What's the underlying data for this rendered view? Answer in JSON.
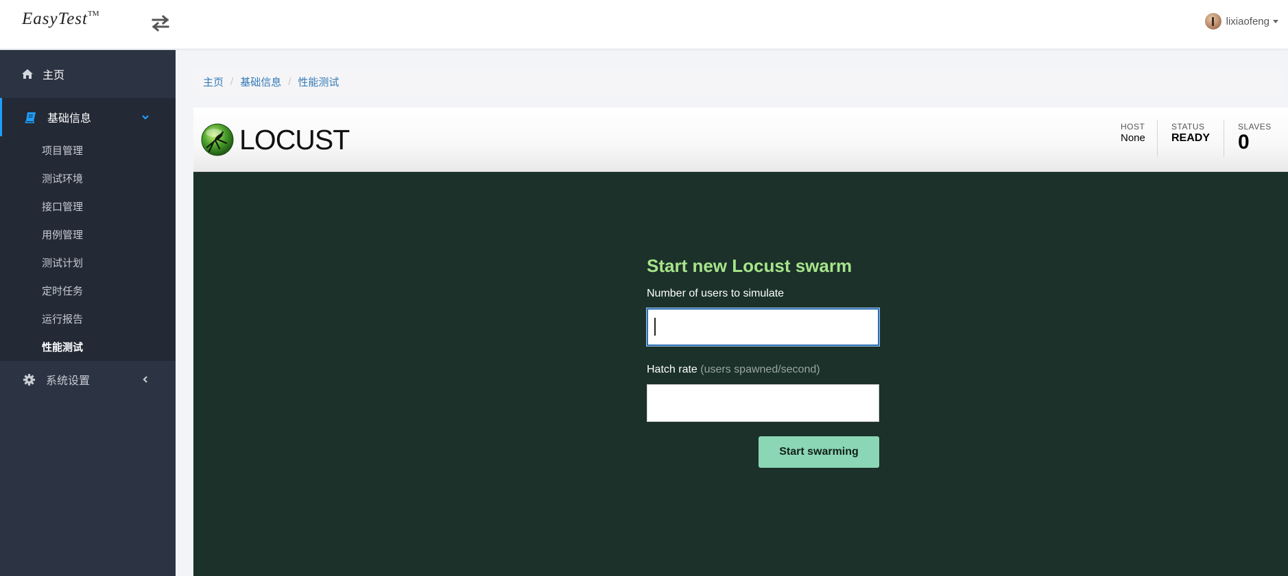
{
  "header": {
    "logo_text": "EasyTest",
    "logo_tm": "TM",
    "user_name": "lixiaofeng"
  },
  "sidebar": {
    "home_label": "主页",
    "group": {
      "label": "基础信息",
      "items": [
        {
          "label": "项目管理"
        },
        {
          "label": "测试环境"
        },
        {
          "label": "接口管理"
        },
        {
          "label": "用例管理"
        },
        {
          "label": "测试计划"
        },
        {
          "label": "定时任务"
        },
        {
          "label": "运行报告"
        },
        {
          "label": "性能测试",
          "active": true
        }
      ]
    },
    "settings_label": "系统设置"
  },
  "breadcrumb": [
    "主页",
    "基础信息",
    "性能测试"
  ],
  "locust": {
    "logo_word": "LOCUST",
    "host": {
      "label": "HOST",
      "value": "None"
    },
    "status": {
      "label": "STATUS",
      "value": "READY"
    },
    "slaves": {
      "label": "SLAVES",
      "value": "0"
    }
  },
  "swarm_form": {
    "title": "Start new Locust swarm",
    "users_label": "Number of users to simulate",
    "users_value": "",
    "hatch_label": "Hatch rate",
    "hatch_hint": "(users spawned/second)",
    "hatch_value": "",
    "submit_label": "Start swarming"
  },
  "colors": {
    "sidebar_bg": "#2c3443",
    "accent_blue": "#1e9fff",
    "panel_bg": "#1b3129",
    "title_green": "#a7e48a",
    "button_green": "#8bd6b5"
  }
}
